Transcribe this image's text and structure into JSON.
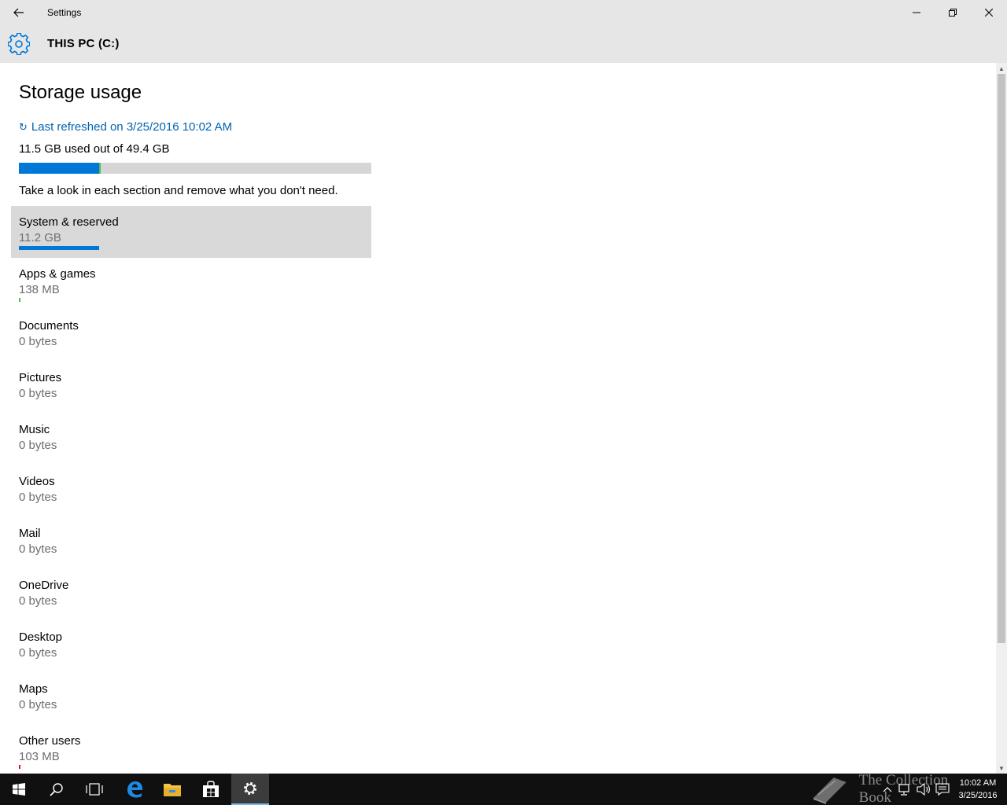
{
  "window": {
    "title": "Settings"
  },
  "header": {
    "title": "THIS PC (C:)"
  },
  "storage": {
    "title": "Storage usage",
    "refresh_text": "Last refreshed on 3/25/2016 10:02 AM",
    "usage_text": "11.5 GB used out of 49.4 GB",
    "used_fraction": 0.233,
    "hint": "Take a look in each section and remove what you don't need."
  },
  "categories": [
    {
      "name": "System & reserved",
      "size": "11.2 GB",
      "bar_fraction": 0.227,
      "bar_color": "#0078d7",
      "selected": true
    },
    {
      "name": "Apps & games",
      "size": "138 MB",
      "bar_fraction": 0.003,
      "bar_color": "#5db65d",
      "selected": false
    },
    {
      "name": "Documents",
      "size": "0 bytes",
      "bar_fraction": 0,
      "bar_color": "#0078d7",
      "selected": false
    },
    {
      "name": "Pictures",
      "size": "0 bytes",
      "bar_fraction": 0,
      "bar_color": "#0078d7",
      "selected": false
    },
    {
      "name": "Music",
      "size": "0 bytes",
      "bar_fraction": 0,
      "bar_color": "#0078d7",
      "selected": false
    },
    {
      "name": "Videos",
      "size": "0 bytes",
      "bar_fraction": 0,
      "bar_color": "#0078d7",
      "selected": false
    },
    {
      "name": "Mail",
      "size": "0 bytes",
      "bar_fraction": 0,
      "bar_color": "#0078d7",
      "selected": false
    },
    {
      "name": "OneDrive",
      "size": "0 bytes",
      "bar_fraction": 0,
      "bar_color": "#0078d7",
      "selected": false
    },
    {
      "name": "Desktop",
      "size": "0 bytes",
      "bar_fraction": 0,
      "bar_color": "#0078d7",
      "selected": false
    },
    {
      "name": "Maps",
      "size": "0 bytes",
      "bar_fraction": 0,
      "bar_color": "#0078d7",
      "selected": false
    },
    {
      "name": "Other users",
      "size": "103 MB",
      "bar_fraction": 0.003,
      "bar_color": "#e81123",
      "selected": false
    }
  ],
  "colors": {
    "accent": "#0078d7",
    "link": "#0063b1"
  },
  "taskbar": {
    "items": [
      "windows-start-icon",
      "search-icon",
      "task-view-icon",
      "edge-icon",
      "file-explorer-icon",
      "store-icon",
      "settings-icon"
    ],
    "active": "settings-icon",
    "watermark": "The Collection Book",
    "clock_time": "10:02 AM",
    "clock_date": "3/25/2016"
  }
}
